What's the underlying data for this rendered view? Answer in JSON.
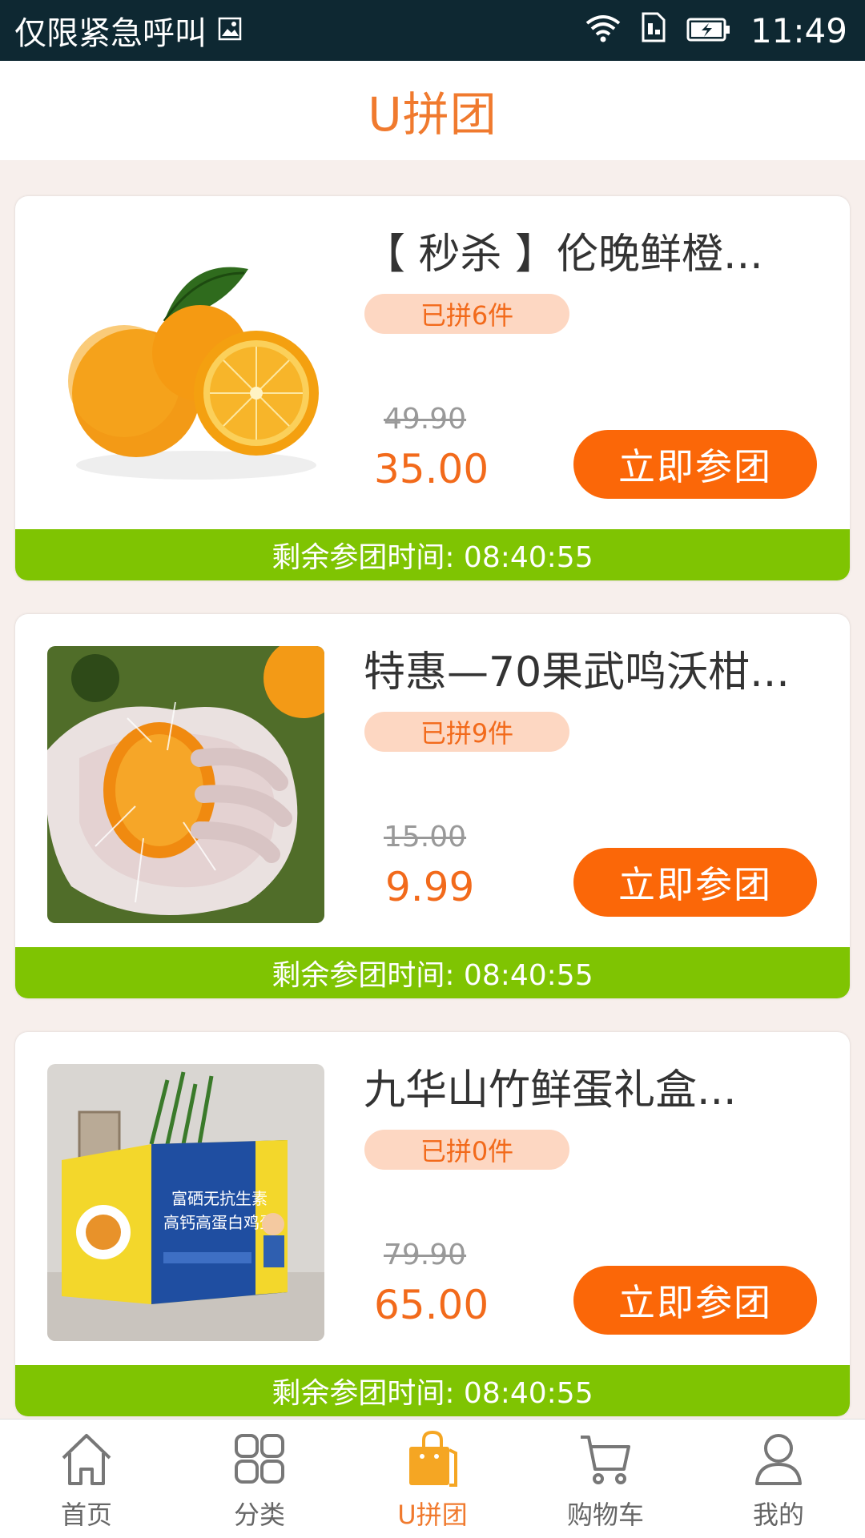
{
  "status_bar": {
    "carrier_text": "仅限紧急呼叫",
    "time": "11:49",
    "icons": [
      "image-icon",
      "wifi-icon",
      "sim-icon",
      "battery-charging-icon"
    ]
  },
  "header": {
    "title": "U拼团"
  },
  "products": [
    {
      "title": "【 秒杀 】伦晚鲜橙...",
      "joined": "已拼6件",
      "original_price": "49.90",
      "price": "35.00",
      "button_label": "立即参团",
      "countdown": "剩余参团时间: 08:40:55",
      "image": "oranges-photo"
    },
    {
      "title": "特惠—70果武鸣沃柑...",
      "joined": "已拼9件",
      "original_price": "15.00",
      "price": "9.99",
      "button_label": "立即参团",
      "countdown": "剩余参团时间: 08:40:55",
      "image": "squeezed-orange-photo"
    },
    {
      "title": "九华山竹鲜蛋礼盒...",
      "joined": "已拼0件",
      "original_price": "79.90",
      "price": "65.00",
      "button_label": "立即参团",
      "countdown": "剩余参团时间: 08:40:55",
      "image": "egg-gift-box-photo",
      "box_text": "富硒无抗生素 高钙高蛋白鸡蛋"
    }
  ],
  "bottom_nav": [
    {
      "label": "首页",
      "icon": "home-icon",
      "active": false
    },
    {
      "label": "分类",
      "icon": "grid-icon",
      "active": false
    },
    {
      "label": "U拼团",
      "icon": "shopping-bag-icon",
      "active": true
    },
    {
      "label": "购物车",
      "icon": "cart-icon",
      "active": false
    },
    {
      "label": "我的",
      "icon": "user-icon",
      "active": false
    }
  ],
  "colors": {
    "accent": "#f26a1b",
    "button": "#fb6708",
    "countdown_bar": "#7fc402",
    "badge_bg": "#fdd7c2",
    "status_bar": "#0e2832"
  }
}
